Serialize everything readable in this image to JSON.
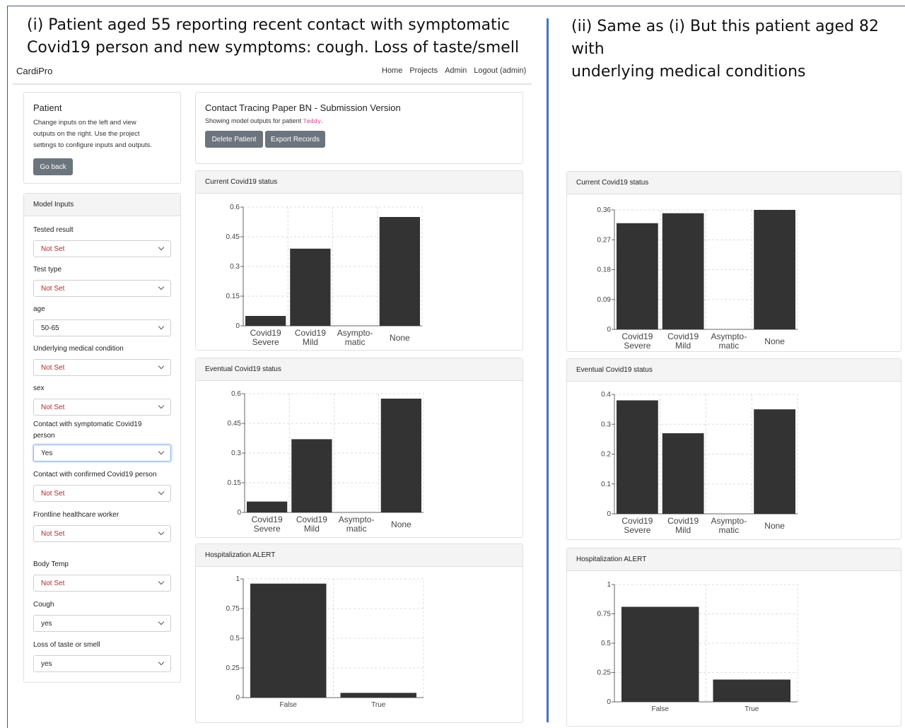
{
  "captions": {
    "left": [
      "(i) Patient aged 55 reporting recent contact with symptomatic",
      "Covid19 person and new symptoms: cough. Loss of taste/smell"
    ],
    "right": [
      "(ii) Same as (i) But this patient aged 82 with",
      "underlying medical conditions"
    ]
  },
  "app": {
    "brand": "CardiPro",
    "nav": [
      "Home",
      "Projects",
      "Admin",
      "Logout (admin)"
    ]
  },
  "patient_card": {
    "title": "Patient",
    "description": [
      "Change inputs on the left and view",
      "outputs on the right. Use the project",
      "settings to configure inputs and outputs."
    ],
    "go_back": "Go back"
  },
  "model_inputs": {
    "header": "Model Inputs",
    "fields": [
      {
        "label": "Tested result",
        "value": "Not Set"
      },
      {
        "label": "Test type",
        "value": "Not Set"
      },
      {
        "label": "age",
        "value": "50-65"
      },
      {
        "label": "Underlying medical condition",
        "value": "Not Set"
      },
      {
        "label": "sex",
        "value": "Not Set"
      },
      {
        "label": "Contact with symptomatic Covid19 person",
        "value": "Yes"
      },
      {
        "label": "Contact with confirmed Covid19 person",
        "value": "Not Set"
      },
      {
        "label": "Frontline healthcare worker",
        "value": "Not Set"
      },
      {
        "label": "Body Temp",
        "value": "Not Set"
      },
      {
        "label": "Cough",
        "value": "yes"
      },
      {
        "label": "Loss of taste or smell",
        "value": "yes"
      }
    ]
  },
  "project_card": {
    "title": "Contact Tracing Paper BN - Submission Version",
    "subtitle_prefix": "Showing model outputs for patient ",
    "patient_name": "Teddy",
    "subtitle_suffix": ".",
    "delete_button": "Delete Patient",
    "export_button": "Export Records"
  },
  "colors": {
    "bar": "#333333",
    "notset": "#b02a2a",
    "patient_name": "#d63384",
    "divider": "#4472c4"
  },
  "chart_data": [
    {
      "id": "left-current",
      "type": "bar",
      "title": "Current Covid19 status",
      "categories": [
        [
          "Covid19",
          "Severe"
        ],
        [
          "Covid19",
          "Mild"
        ],
        [
          "Asympto-",
          "matic"
        ],
        [
          "None"
        ]
      ],
      "values": [
        0.05,
        0.39,
        0.0,
        0.55
      ],
      "ylim": [
        0,
        0.6
      ],
      "yticks": [
        "0",
        "0.15",
        "0.3",
        "0.45",
        "0.6"
      ],
      "ytick_values": [
        0,
        0.15,
        0.3,
        0.45,
        0.6
      ]
    },
    {
      "id": "left-eventual",
      "type": "bar",
      "title": "Eventual Covid19 status",
      "categories": [
        [
          "Covid19",
          "Severe"
        ],
        [
          "Covid19",
          "Mild"
        ],
        [
          "Asympto-",
          "matic"
        ],
        [
          "None"
        ]
      ],
      "values": [
        0.055,
        0.37,
        0.0,
        0.575
      ],
      "ylim": [
        0,
        0.6
      ],
      "yticks": [
        "0",
        "0.15",
        "0.3",
        "0.45",
        "0.6"
      ],
      "ytick_values": [
        0,
        0.15,
        0.3,
        0.45,
        0.6
      ]
    },
    {
      "id": "left-hosp",
      "type": "bar",
      "title": "Hospitalization ALERT",
      "categories": [
        [
          "False"
        ],
        [
          "True"
        ]
      ],
      "values": [
        0.96,
        0.04
      ],
      "ylim": [
        0,
        1
      ],
      "yticks": [
        "0",
        "0.25",
        "0.5",
        "0.75",
        "1"
      ],
      "ytick_values": [
        0,
        0.25,
        0.5,
        0.75,
        1
      ]
    },
    {
      "id": "right-current",
      "type": "bar",
      "title": "Current Covid19 status",
      "categories": [
        [
          "Covid19",
          "Severe"
        ],
        [
          "Covid19",
          "Mild"
        ],
        [
          "Asympto-",
          "matic"
        ],
        [
          "None"
        ]
      ],
      "values": [
        0.32,
        0.35,
        0.0,
        0.36
      ],
      "ylim": [
        0,
        0.36
      ],
      "yticks": [
        "0",
        "0.09",
        "0.18",
        "0.27",
        "0.36"
      ],
      "ytick_values": [
        0,
        0.09,
        0.18,
        0.27,
        0.36
      ]
    },
    {
      "id": "right-eventual",
      "type": "bar",
      "title": "Eventual Covid19 status",
      "categories": [
        [
          "Covid19",
          "Severe"
        ],
        [
          "Covid19",
          "Mild"
        ],
        [
          "Asympto-",
          "matic"
        ],
        [
          "None"
        ]
      ],
      "values": [
        0.38,
        0.27,
        0.0,
        0.35
      ],
      "ylim": [
        0,
        0.4
      ],
      "yticks": [
        "0",
        "0.1",
        "0.2",
        "0.3",
        "0.4"
      ],
      "ytick_values": [
        0,
        0.1,
        0.2,
        0.3,
        0.4
      ]
    },
    {
      "id": "right-hosp",
      "type": "bar",
      "title": "Hospitalization ALERT",
      "categories": [
        [
          "False"
        ],
        [
          "True"
        ]
      ],
      "values": [
        0.81,
        0.19
      ],
      "ylim": [
        0,
        1
      ],
      "yticks": [
        "0",
        "0.25",
        "0.5",
        "0.75",
        "1"
      ],
      "ytick_values": [
        0,
        0.25,
        0.5,
        0.75,
        1
      ]
    }
  ]
}
